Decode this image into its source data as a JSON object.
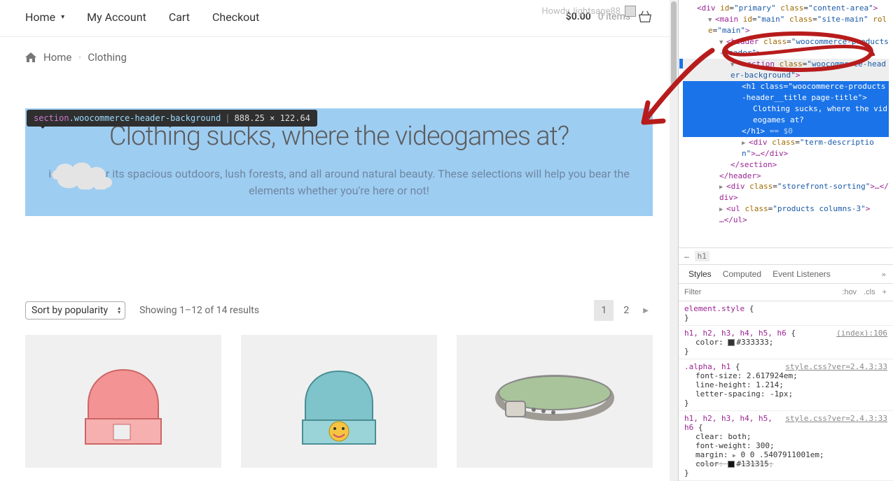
{
  "nav": {
    "home": "Home",
    "myaccount": "My Account",
    "cart": "Cart",
    "checkout": "Checkout"
  },
  "cart": {
    "total": "$0.00",
    "items": "0 items"
  },
  "howdy": {
    "text": "Howdy, lightsage88"
  },
  "breadcrumb": {
    "home": "Home",
    "current": "Clothing"
  },
  "tooltip": {
    "tag": "section",
    "class": ".woocommerce-header-background",
    "dims": "888.25 × 122.64"
  },
  "hero": {
    "title": "Clothing sucks, where the videogames at?",
    "desc": " is known for its spacious outdoors, lush forests, and all around natural beauty. These selections will help you bear the elements whether you're here or not!"
  },
  "sort": {
    "selected": "Sort by popularity",
    "results": "Showing 1–12 of 14 results"
  },
  "pagination": {
    "p1": "1",
    "p2": "2"
  },
  "dom": {
    "l0": "<div id=\"primary\" class=\"content-area\">",
    "l1_pre": "<main id=\"",
    "l1_id": "main",
    "l1_mid": "\" class=\"",
    "l1_cls": "site-main",
    "l1_mid2": "\" role=\"",
    "l1_role": "main",
    "l1_end": "\">",
    "l2": "<header class=\"woocommerce-products-header\">",
    "l3": "<section class=\"woocommerce-header-background\">",
    "l4": "<h1 class=\"woocommerce-products-header__title page-title\">",
    "l5": "Clothing sucks, where the videogames at?",
    "l6a": "</h1>",
    "l6b": " == $0",
    "l7": "<div class=\"term-description\">…</div>",
    "l8": "</section>",
    "l9": "</header>",
    "l10": "<div class=\"storefront-sorting\">…</div>",
    "l11": "<ul class=\"products columns-3\">…</ul>"
  },
  "crumbs": {
    "ell": "…",
    "cur": "h1"
  },
  "tabs": {
    "styles": "Styles",
    "computed": "Computed",
    "events": "Event Listeners"
  },
  "filter": {
    "placeholder": "Filter",
    "hov": ":hov",
    "cls": ".cls",
    "plus": "+"
  },
  "rules": {
    "r0_sel": "element.style",
    "r0_open": " {",
    "r0_close": "}",
    "r1_sel": "h1, h2, h3, h4, h5, h6",
    "r1_open": " {",
    "r1_src": "(index):106",
    "r1_p1": "color",
    "r1_v1": "#333333",
    "r1_close": "}",
    "r2_sel": ".alpha, h1",
    "r2_open": " {",
    "r2_src": "style.css?ver=2.4.3:33",
    "r2_p1": "font-size",
    "r2_v1": "2.617924em",
    "r2_p2": "line-height",
    "r2_v2": "1.214",
    "r2_p3": "letter-spacing",
    "r2_v3": "-1px",
    "r2_close": "}",
    "r3_sel": "h1, h2, h3, h4, h5, h6",
    "r3_open": " {",
    "r3_src": "style.css?ver=2.4.3:33",
    "r3_p1": "clear",
    "r3_v1": "both",
    "r3_p2": "font-weight",
    "r3_v2": "300",
    "r3_p3": "margin",
    "r3_v3": "0 0 .5407911001em",
    "r3_p4": "color",
    "r3_v4": "#131315",
    "r3_close": "}"
  }
}
